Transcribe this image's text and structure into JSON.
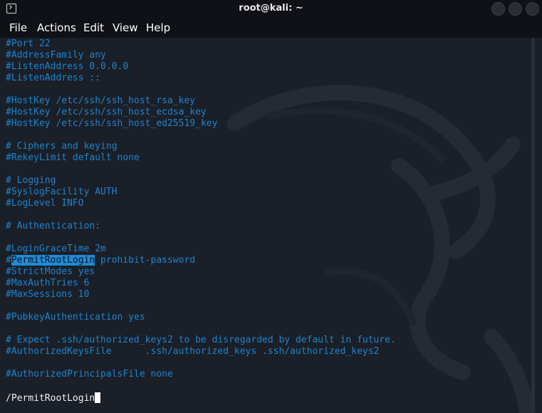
{
  "window": {
    "title": "root@kali: ~",
    "icon": "terminal-icon"
  },
  "menu": {
    "items": [
      "File",
      "Actions",
      "Edit",
      "View",
      "Help"
    ]
  },
  "terminal": {
    "lines": [
      "#Port 22",
      "#AddressFamily any",
      "#ListenAddress 0.0.0.0",
      "#ListenAddress ::",
      "",
      "#HostKey /etc/ssh/ssh_host_rsa_key",
      "#HostKey /etc/ssh/ssh_host_ecdsa_key",
      "#HostKey /etc/ssh/ssh_host_ed25519_key",
      "",
      "# Ciphers and keying",
      "#RekeyLimit default none",
      "",
      "# Logging",
      "#SyslogFacility AUTH",
      "#LogLevel INFO",
      "",
      "# Authentication:",
      "",
      "#LoginGraceTime 2m",
      {
        "prefix": "#",
        "match": "PermitRootLogin",
        "suffix": " prohibit-password"
      },
      "#StrictModes yes",
      "#MaxAuthTries 6",
      "#MaxSessions 10",
      "",
      "#PubkeyAuthentication yes",
      "",
      "# Expect .ssh/authorized_keys2 to be disregarded by default in future.",
      "#AuthorizedKeysFile      .ssh/authorized_keys .ssh/authorized_keys2",
      "",
      "#AuthorizedPrincipalsFile none"
    ],
    "command_line": "/PermitRootLogin",
    "colors": {
      "text": "#1c84cf",
      "highlight_bg": "#1f8ad8",
      "background": "#1b1f27"
    }
  }
}
